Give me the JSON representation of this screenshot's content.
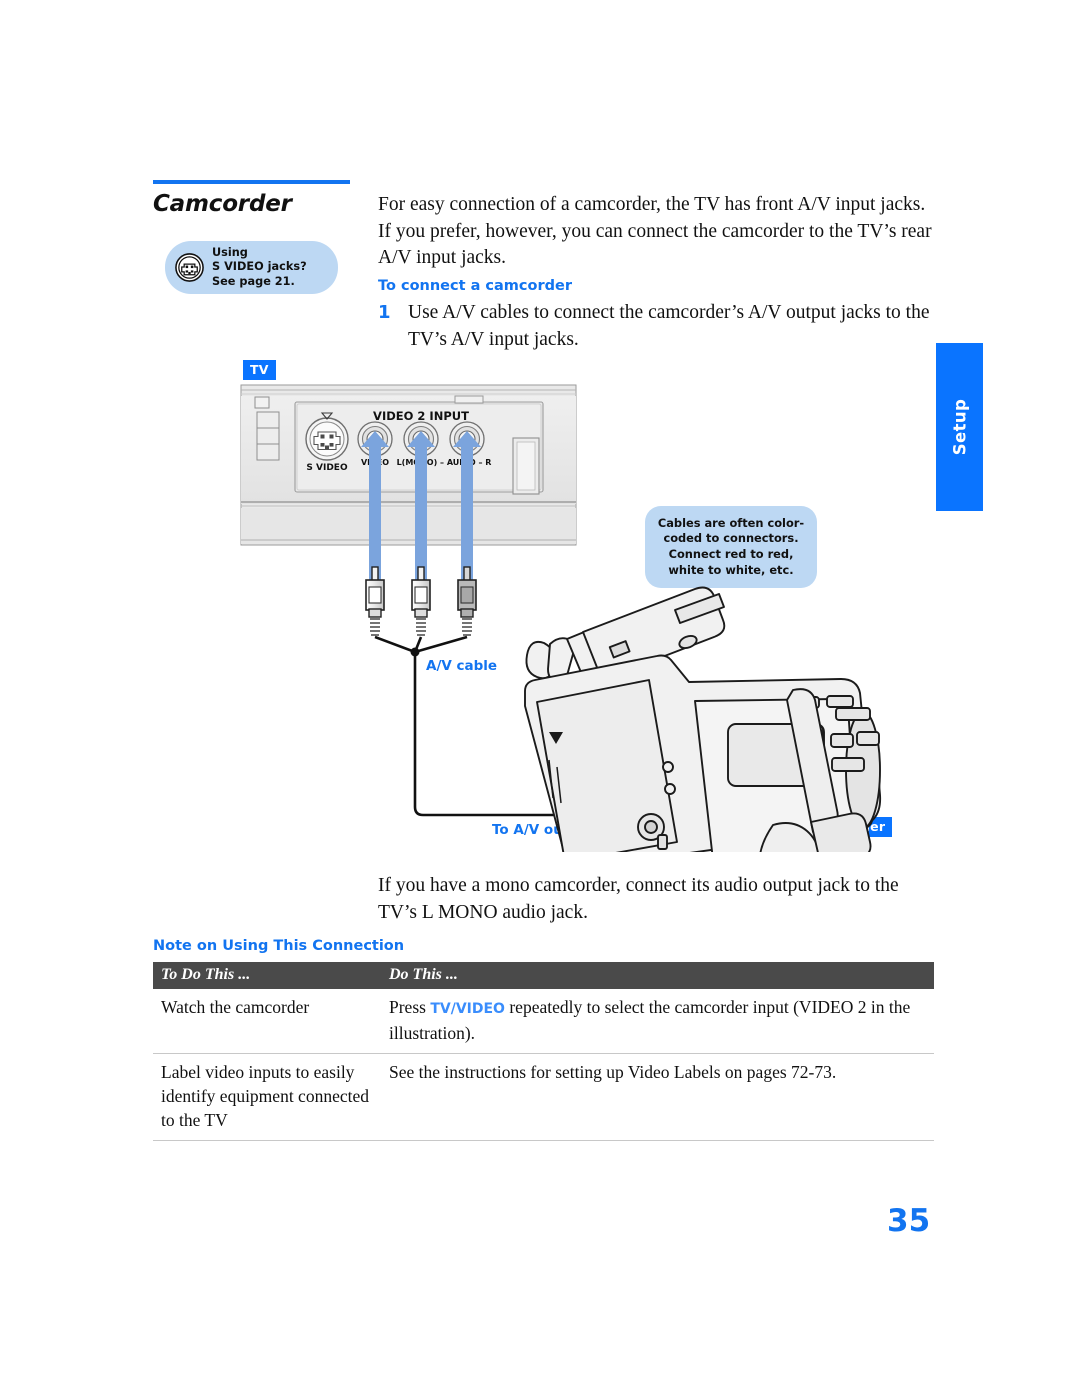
{
  "section": {
    "title": "Camcorder",
    "tip": {
      "icon": "s-video-connector-icon",
      "line1": "Using",
      "line2": "S VIDEO jacks?",
      "line3": "See page 21."
    }
  },
  "intro": "For easy connection of a camcorder, the TV has front A/V input jacks. If you prefer, however, you can connect the camcorder to the TV’s rear A/V input jacks.",
  "procedure": {
    "heading": "To connect a camcorder",
    "step_number": "1",
    "step_text": "Use A/V cables to connect the camcorder’s A/V output jacks to the TV’s A/V input jacks."
  },
  "mono_note": "If you have a mono camcorder, connect its audio output jack to the TV’s L MONO audio jack.",
  "side_tab": {
    "label": "Setup"
  },
  "illustration": {
    "tv_badge": "TV",
    "camcorder_badge": "Camcorder",
    "panel": {
      "group_label": "VIDEO 2 INPUT",
      "s_video_label": "S VIDEO",
      "video_label": "VIDEO",
      "audio_label": "L(MONO) – AUDIO – R"
    },
    "cable_note": "Cables are often color-coded to connectors. Connect red to red, white to white, etc.",
    "av_cable_label": "A/V cable",
    "av_output_label": "To A/V output",
    "plug_colors": [
      "#ffffff",
      "#ffffff",
      "#a8a8a8"
    ]
  },
  "note_table": {
    "heading": "Note on Using This Connection",
    "columns": [
      "To Do This ...",
      "Do This ..."
    ],
    "rows": [
      {
        "to_do": "Watch the camcorder",
        "do_pre": "Press ",
        "do_kw": "TV/VIDEO",
        "do_post": " repeatedly to select the camcorder input (VIDEO 2 in the illustration)."
      },
      {
        "to_do": "Label video inputs to easily identify equipment connected to the TV",
        "do_pre": "See the instructions for setting up Video Labels on pages 72-73.",
        "do_kw": "",
        "do_post": ""
      }
    ]
  },
  "page_number": "35",
  "colors": {
    "accent": "#1274f0",
    "badge": "#0a74ff",
    "pill": "#bdd8f3",
    "table_header": "#4a4a4a"
  }
}
